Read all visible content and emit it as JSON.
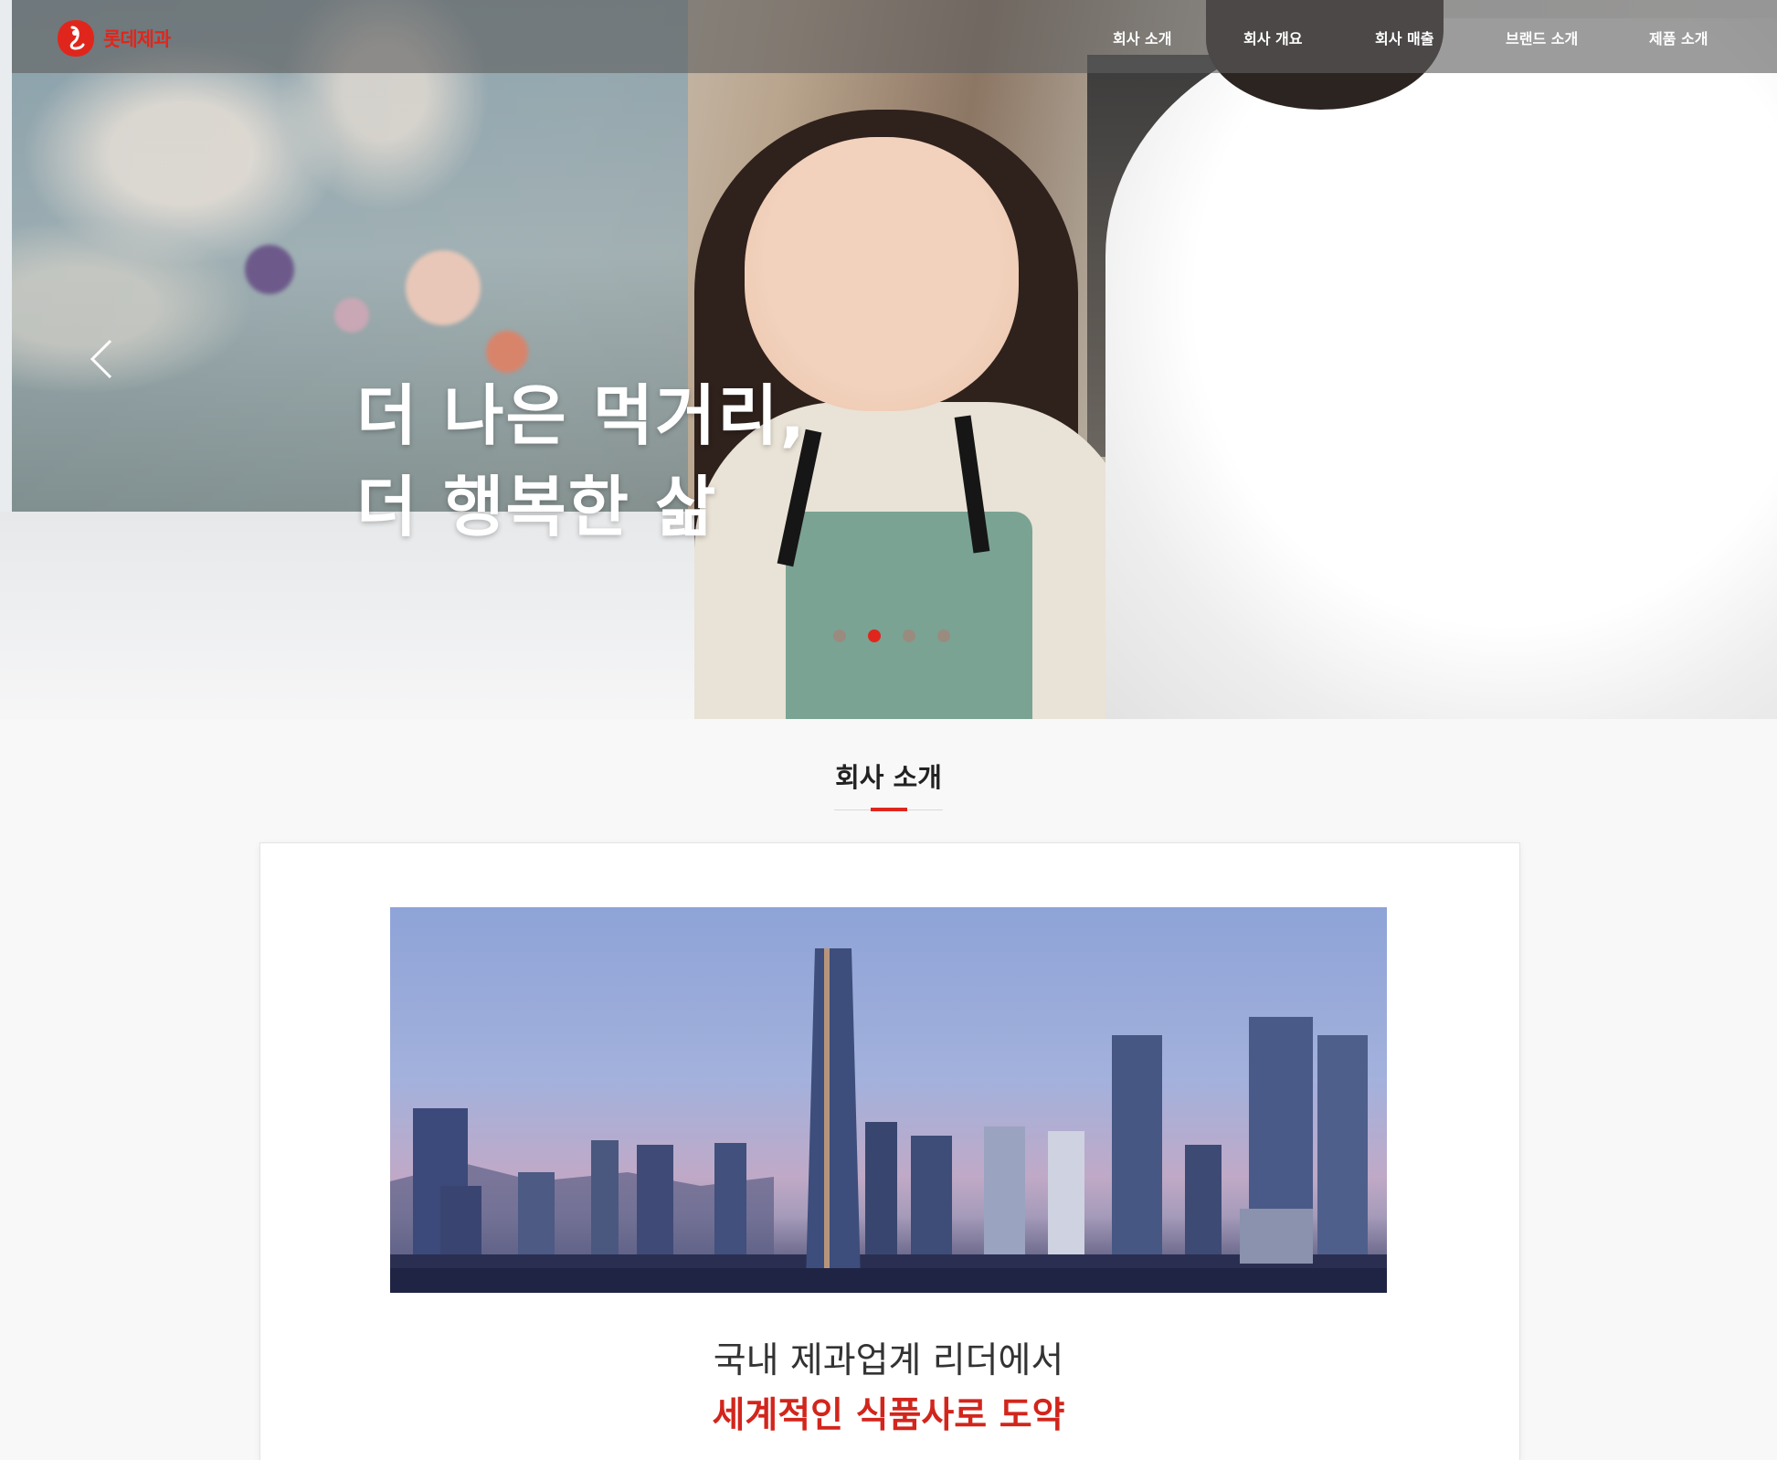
{
  "brand": {
    "logo_text": "롯데제과",
    "accent_color": "#e0261c"
  },
  "nav": {
    "items": [
      {
        "label": "회사 소개"
      },
      {
        "label": "회사 개요"
      },
      {
        "label": "회사 매출"
      },
      {
        "label": "브랜드 소개"
      },
      {
        "label": "제품 소개"
      }
    ]
  },
  "hero": {
    "headline_line1": "더 나은 먹거리,",
    "headline_line2": "더 행복한 삶",
    "prev_icon": "chevron-left-icon",
    "next_icon": "chevron-right-icon",
    "slide_count": 4,
    "active_slide": 2
  },
  "section": {
    "title": "회사 소개"
  },
  "intro": {
    "line1": "국내 제과업계 리더에서",
    "line2": "세계적인 식품사로 도약"
  }
}
